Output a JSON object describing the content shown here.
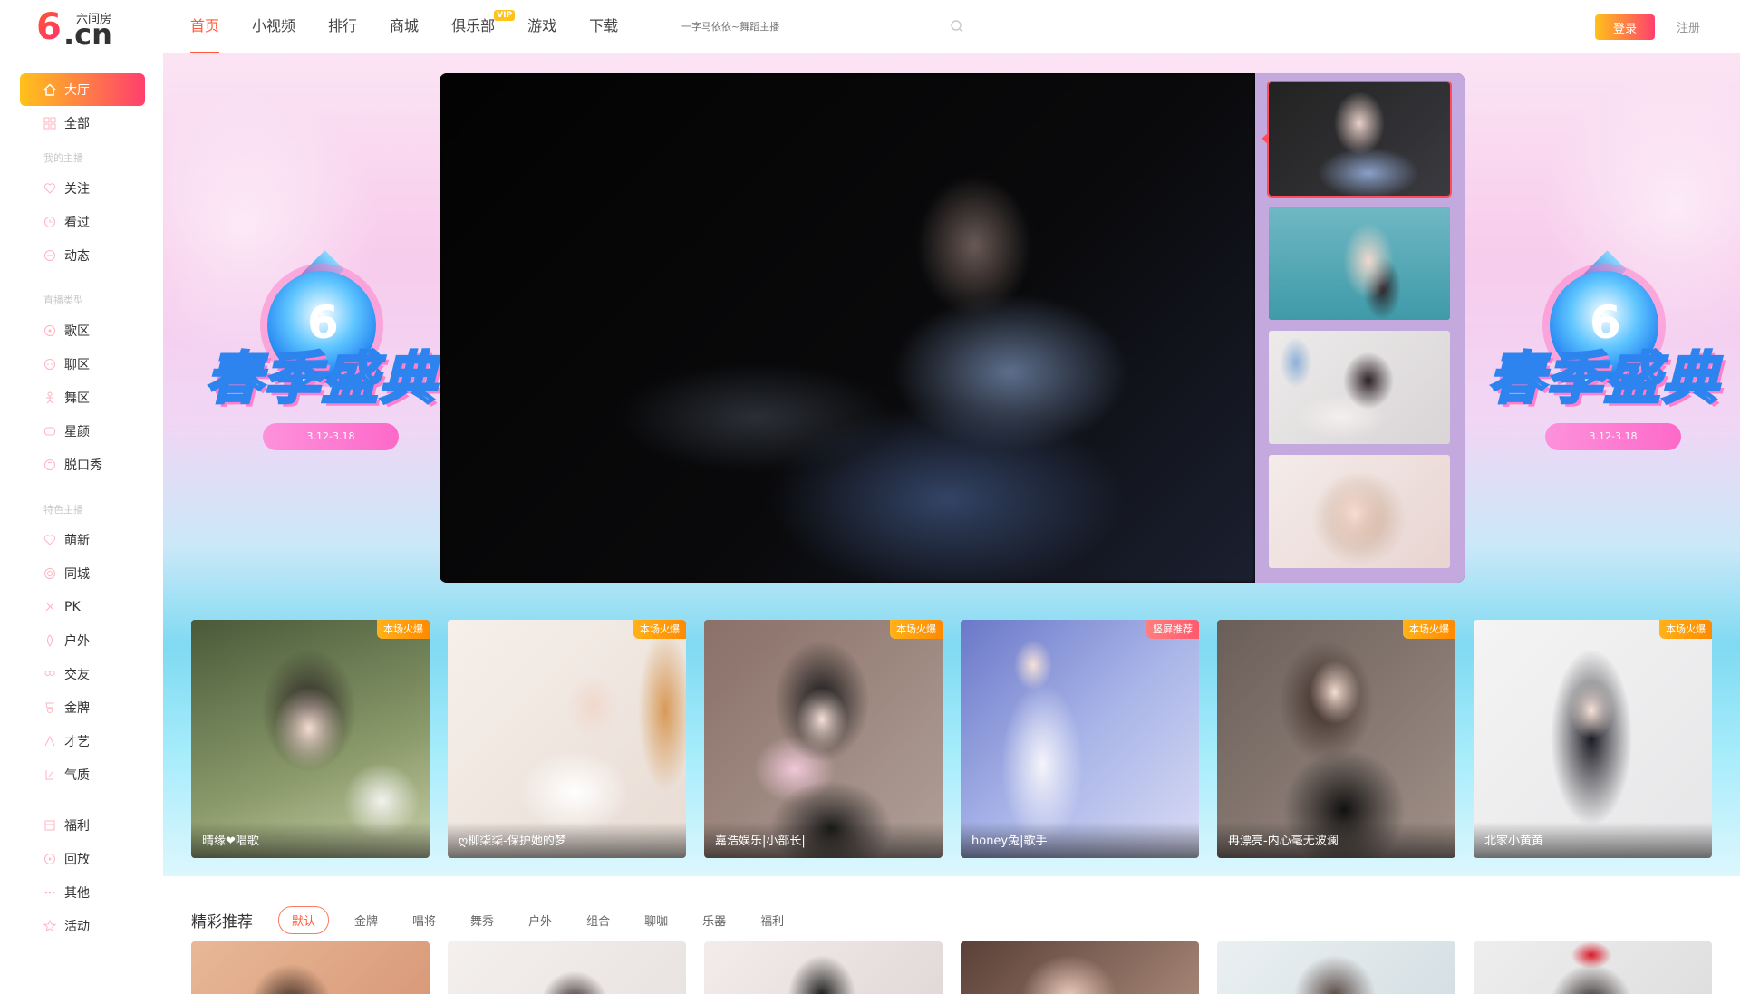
{
  "header": {
    "logo_text": "6.cn",
    "logo_sub": "六间房",
    "nav": [
      {
        "label": "首页",
        "active": true
      },
      {
        "label": "小视频"
      },
      {
        "label": "排行"
      },
      {
        "label": "商城"
      },
      {
        "label": "俱乐部",
        "badge": "VIP"
      },
      {
        "label": "游戏"
      },
      {
        "label": "下载"
      }
    ],
    "search_placeholder": "一字马依依~舞蹈主播",
    "login_label": "登录",
    "register_label": "注册"
  },
  "sidebar": {
    "items": [
      {
        "label": "大厅",
        "icon": "home-icon",
        "active": true
      },
      {
        "label": "全部",
        "icon": "grid-icon"
      },
      {
        "label": "关注",
        "icon": "heart-icon"
      },
      {
        "label": "看过",
        "icon": "clock-icon"
      },
      {
        "label": "动态",
        "icon": "message-icon"
      },
      {
        "label": "歌区",
        "icon": "music-icon"
      },
      {
        "label": "聊区",
        "icon": "chat-icon"
      },
      {
        "label": "舞区",
        "icon": "dance-icon"
      },
      {
        "label": "星颜",
        "icon": "star-face-icon"
      },
      {
        "label": "脱口秀",
        "icon": "mic-icon"
      },
      {
        "label": "萌新",
        "icon": "sprout-icon"
      },
      {
        "label": "同城",
        "icon": "location-icon"
      },
      {
        "label": "PK",
        "icon": "pk-icon"
      },
      {
        "label": "户外",
        "icon": "outdoor-icon"
      },
      {
        "label": "交友",
        "icon": "friends-icon"
      },
      {
        "label": "金牌",
        "icon": "medal-icon"
      },
      {
        "label": "才艺",
        "icon": "talent-icon"
      },
      {
        "label": "气质",
        "icon": "temperament-icon"
      },
      {
        "label": "福利",
        "icon": "gift-icon"
      },
      {
        "label": "回放",
        "icon": "replay-icon"
      },
      {
        "label": "其他",
        "icon": "more-icon"
      },
      {
        "label": "活动",
        "icon": "event-icon"
      }
    ],
    "sections": [
      "我的主播",
      "直播类型",
      "特色主播"
    ]
  },
  "banner": {
    "event_title": "春季盛典",
    "event_date": "3.12-3.18"
  },
  "featured": [
    {
      "name": "晴缘❤唱歌",
      "tag": "本场火爆"
    },
    {
      "name": "ღ柳柒柒-保护她的梦",
      "tag": "本场火爆"
    },
    {
      "name": "嘉浩娱乐|小部长|",
      "tag": "本场火爆"
    },
    {
      "name": "honey兔|歌手",
      "tag": "竖屏推荐"
    },
    {
      "name": "冉漂亮-内心毫无波澜",
      "tag": "本场火爆"
    },
    {
      "name": "北家小黄黄",
      "tag": "本场火爆"
    }
  ],
  "recommend": {
    "title": "精彩推荐",
    "tabs": [
      {
        "label": "默认",
        "active": true
      },
      {
        "label": "金牌"
      },
      {
        "label": "唱将"
      },
      {
        "label": "舞秀"
      },
      {
        "label": "户外"
      },
      {
        "label": "组合"
      },
      {
        "label": "聊咖"
      },
      {
        "label": "乐器"
      },
      {
        "label": "福利"
      }
    ]
  },
  "colors": {
    "accent": "#ff5a3a",
    "brand_gradient_start": "#ffc21a",
    "brand_gradient_end": "#ff3f6e"
  }
}
